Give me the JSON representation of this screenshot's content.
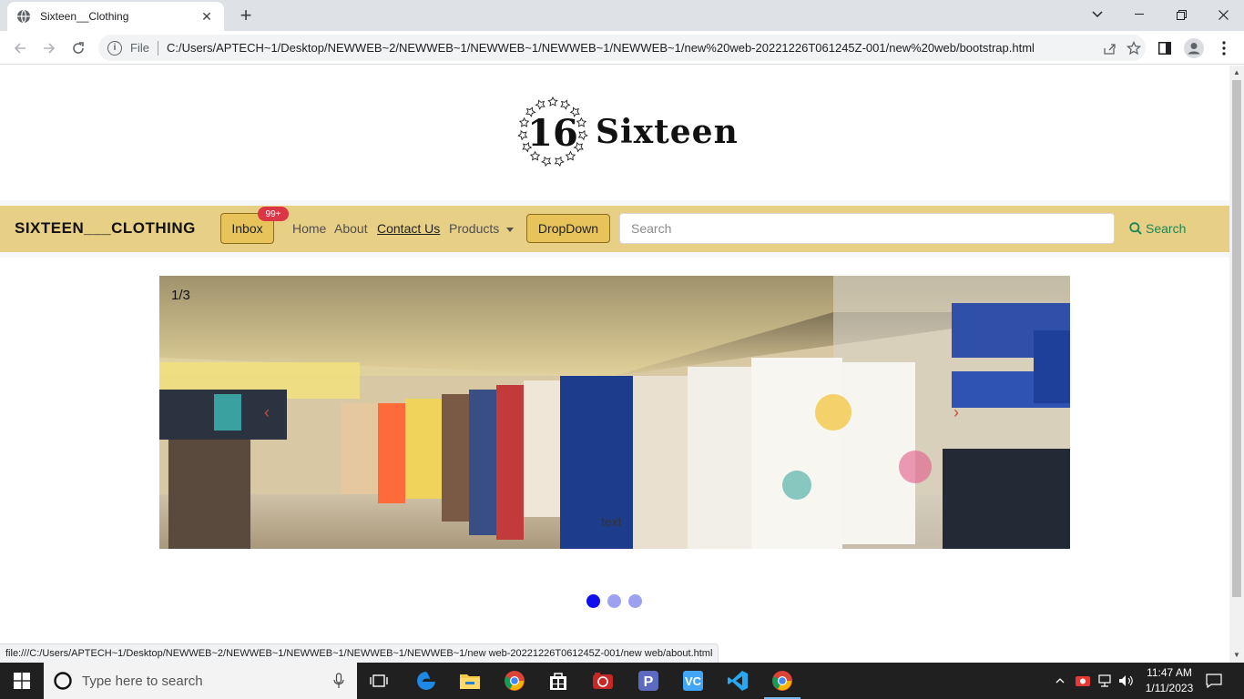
{
  "browser": {
    "tab_title": "Sixteen__Clothing",
    "new_tab": "+",
    "omnibox_scheme": "File",
    "url": "C:/Users/APTECH~1/Desktop/NEWWEB~2/NEWWEB~1/NEWWEB~1/NEWWEB~1/NEWWEB~1/new%20web-20221226T061245Z-001/new%20web/bootstrap.html",
    "status_url": "file:///C:/Users/APTECH~1/Desktop/NEWWEB~2/NEWWEB~1/NEWWEB~1/NEWWEB~1/NEWWEB~1/new web-20221226T061245Z-001/new web/about.html"
  },
  "page": {
    "logo_text": "Sixteen",
    "logo_numeral": "16",
    "navbar": {
      "brand": "SIXTEEN___CLOTHING",
      "inbox_label": "Inbox",
      "inbox_badge": "99+",
      "links": [
        "Home",
        "About",
        "Contact Us",
        "Products"
      ],
      "dropdown_label": "DropDown",
      "search_placeholder": "Search",
      "search_button": "Search"
    },
    "carousel": {
      "counter": "1/3",
      "prev": "‹",
      "next": "›",
      "caption": "text",
      "slide_count": 3,
      "active_index": 0
    }
  },
  "taskbar": {
    "search_placeholder": "Type here to search",
    "time": "11:47 AM",
    "date": "1/11/2023"
  },
  "colors": {
    "navbar_bg": "#e8cf86",
    "button_bg": "#e8c35a",
    "badge": "#dc3545",
    "search_green": "#198754",
    "dot_active": "#1010ee",
    "dot_inactive": "#9ea0f0"
  }
}
